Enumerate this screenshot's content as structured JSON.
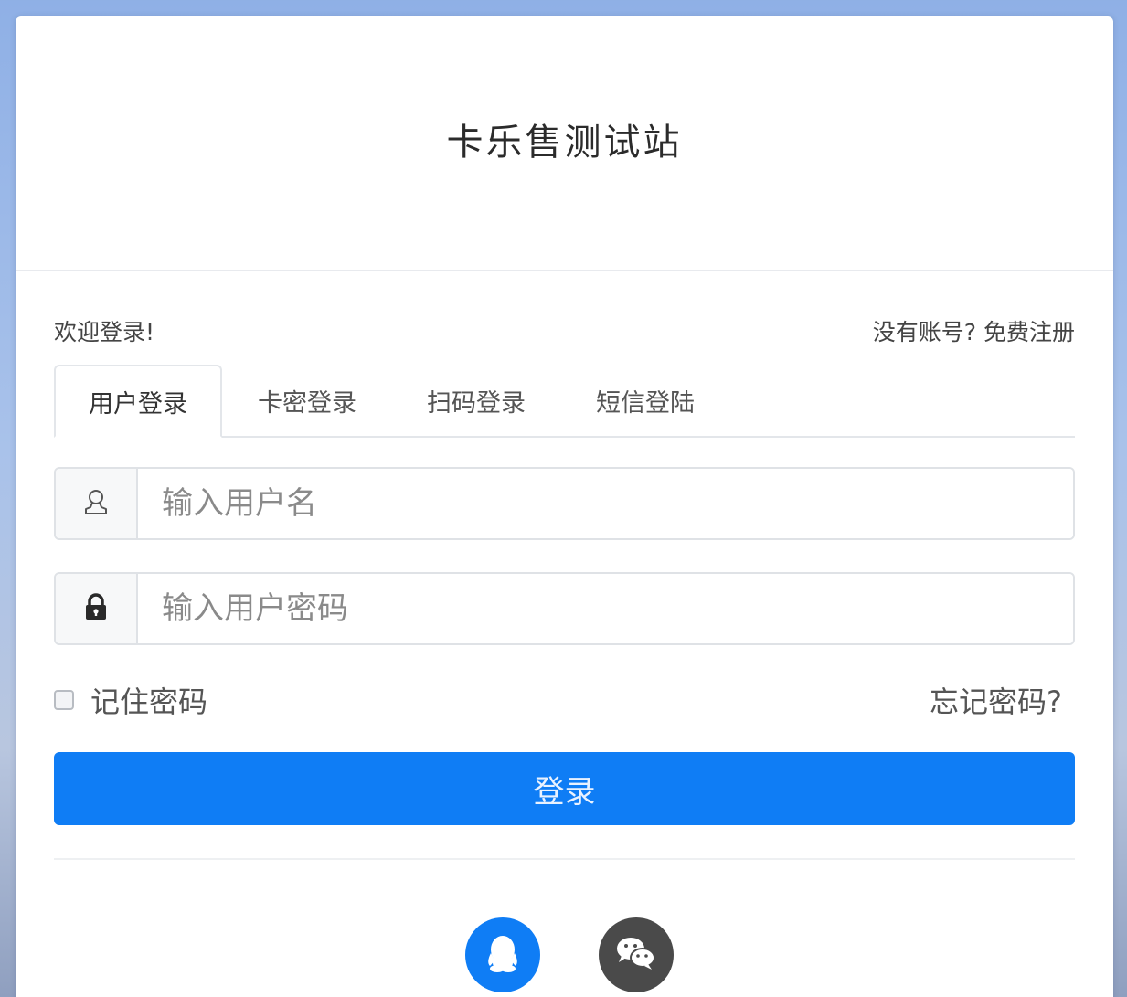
{
  "site": {
    "title": "卡乐售测试站"
  },
  "welcome": {
    "text": "欢迎登录!",
    "register_link": "没有账号? 免费注册"
  },
  "tabs": [
    {
      "label": "用户登录",
      "active": true
    },
    {
      "label": "卡密登录",
      "active": false
    },
    {
      "label": "扫码登录",
      "active": false
    },
    {
      "label": "短信登陆",
      "active": false
    }
  ],
  "form": {
    "username": {
      "placeholder": "输入用户名",
      "value": "",
      "icon": "user-icon"
    },
    "password": {
      "placeholder": "输入用户密码",
      "value": "",
      "icon": "lock-icon"
    },
    "remember_label": "记住密码",
    "remember_checked": false,
    "forgot_link": "忘记密码?",
    "submit_label": "登录"
  },
  "social": [
    {
      "name": "qq",
      "icon": "qq-icon",
      "color": "#0f7df5"
    },
    {
      "name": "wechat",
      "icon": "wechat-icon",
      "color": "#4a4a4a"
    }
  ],
  "colors": {
    "primary": "#0f7df5",
    "background": "#a9c2ea"
  }
}
